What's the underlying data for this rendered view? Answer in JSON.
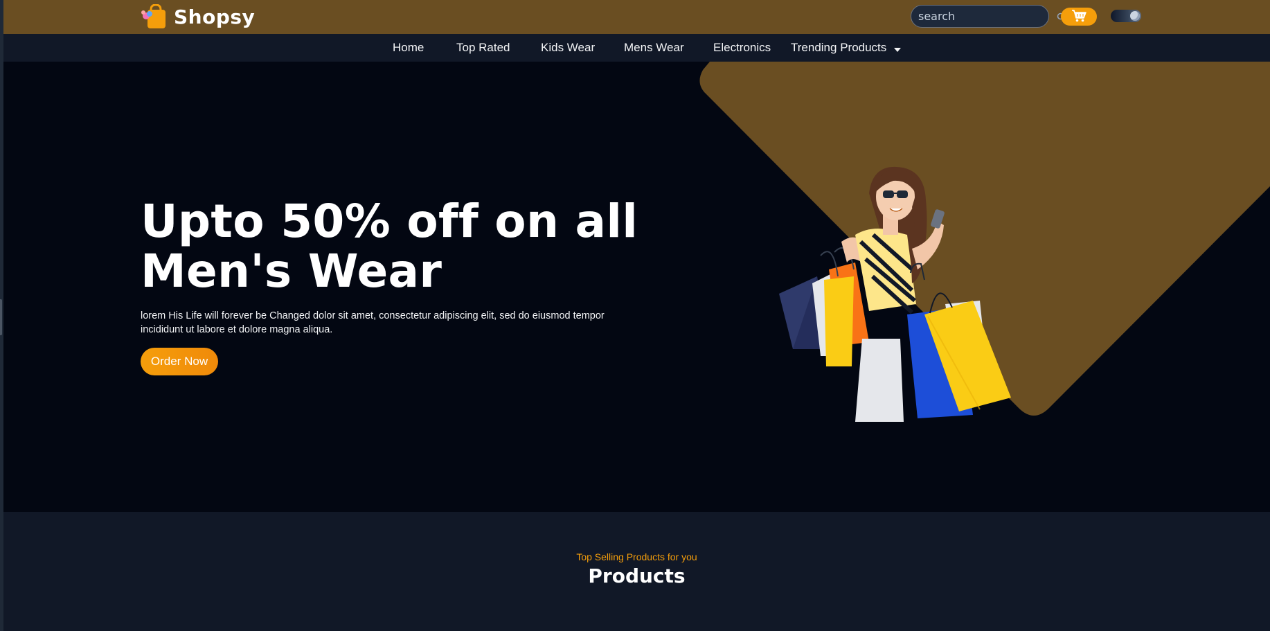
{
  "colors": {
    "topbar_bg": "#6a4e22",
    "accent": "#f59e0b",
    "nav_bg": "#111827",
    "hero_bg": "#030712",
    "hero_shape": "#6a4e22"
  },
  "header": {
    "logo_text": "Shopsy",
    "search": {
      "placeholder": "search",
      "icon": "search-icon"
    },
    "cart_icon": "cart-icon",
    "theme_toggle_icon": "theme-toggle"
  },
  "nav": {
    "items": [
      {
        "label": "Home"
      },
      {
        "label": "Top Rated"
      },
      {
        "label": "Kids Wear"
      },
      {
        "label": "Mens Wear"
      },
      {
        "label": "Electronics"
      },
      {
        "label": "Trending Products",
        "icon": "caret-down-icon"
      }
    ]
  },
  "hero": {
    "title_line1": "Upto 50% off on all",
    "title_line2": "Men's Wear",
    "description": "lorem His Life will forever be Changed dolor sit amet, consectetur adipiscing elit, sed do eiusmod tempor incididunt ut labore et dolore magna aliqua.",
    "button_label": "Order Now",
    "image": "woman-with-shopping-bags"
  },
  "products": {
    "subtitle": "Top Selling Products for you",
    "title": "Products"
  }
}
